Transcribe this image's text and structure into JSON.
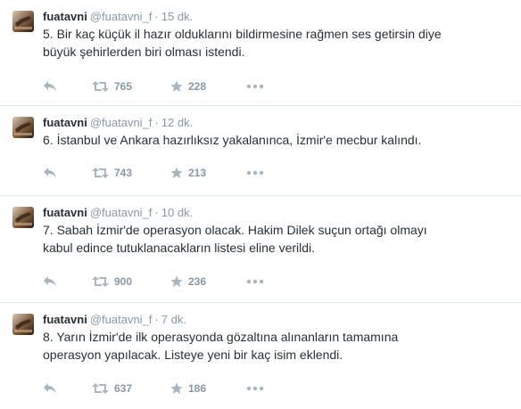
{
  "tweets": [
    {
      "fullname": "fuatavni",
      "username": "@fuatavni_f",
      "separator": "·",
      "time": "15 dk.",
      "text": "5. Bir kaç küçük il hazır olduklarını bildirmesine rağmen ses getirsin diye\nbüyük şehirlerden biri olması istendi.",
      "retweets": "765",
      "favorites": "228"
    },
    {
      "fullname": "fuatavni",
      "username": "@fuatavni_f",
      "separator": "·",
      "time": "12 dk.",
      "text": "6. İstanbul ve Ankara hazırlıksız yakalanınca, İzmir'e mecbur kalındı.",
      "retweets": "743",
      "favorites": "213"
    },
    {
      "fullname": "fuatavni",
      "username": "@fuatavni_f",
      "separator": "·",
      "time": "10 dk.",
      "text": "7. Sabah İzmir'de operasyon olacak. Hakim Dilek suçun ortağı olmayı\nkabul edince tutuklanacakların listesi eline verildi.",
      "retweets": "900",
      "favorites": "236"
    },
    {
      "fullname": "fuatavni",
      "username": "@fuatavni_f",
      "separator": "·",
      "time": "7 dk.",
      "text": "8. Yarın İzmir'de ilk operasyonda gözaltına alınanların tamamına\noperasyon yapılacak. Listeye yeni bir kaç isim eklendi.",
      "retweets": "637",
      "favorites": "186"
    }
  ],
  "icons": {
    "reply": "reply-icon",
    "retweet": "retweet-icon",
    "favorite": "star-icon",
    "more": "more-icon"
  },
  "colors": {
    "text": "#292f33",
    "muted": "#8899a6",
    "divider": "#e1e8ed"
  }
}
